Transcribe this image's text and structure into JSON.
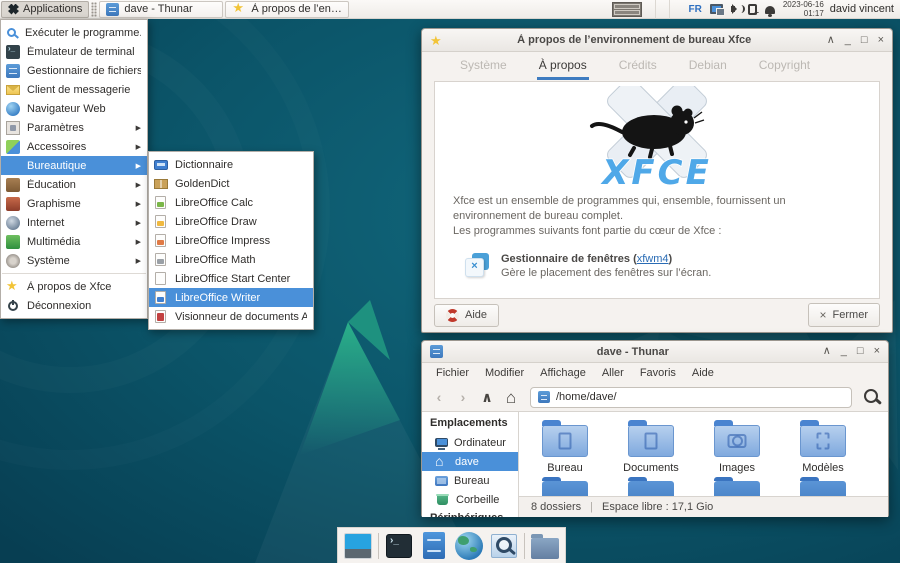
{
  "window_controls": [
    {
      "name": "shade-button",
      "glyph": "∧"
    },
    {
      "name": "minimize-button",
      "glyph": "_"
    },
    {
      "name": "maximize-button",
      "glyph": "□"
    },
    {
      "name": "close-button",
      "glyph": "×"
    }
  ],
  "panel": {
    "applications_label": "Applications",
    "task_buttons": [
      {
        "name": "taskbar-button-thunar",
        "icon": "thunar",
        "label": "dave - Thunar"
      },
      {
        "name": "taskbar-button-about",
        "icon": "star",
        "label": "À propos de l’environnem..."
      }
    ],
    "tray_language": "FR",
    "clock_date": "2023-06-16",
    "clock_time": "01:17",
    "username": "david vincent"
  },
  "apps_menu": {
    "items": [
      {
        "name": "menu-item-executer",
        "icon": "run",
        "label": "Exécuter le programme..."
      },
      {
        "name": "menu-item-terminal",
        "icon": "terminal",
        "label": "Émulateur de terminal"
      },
      {
        "name": "menu-item-gestionnaire-fichiers",
        "icon": "filecab",
        "label": "Gestionnaire de fichiers"
      },
      {
        "name": "menu-item-messagerie",
        "icon": "mail",
        "label": "Client de messagerie"
      },
      {
        "name": "menu-item-navigateur",
        "icon": "globe",
        "label": "Navigateur Web"
      },
      {
        "name": "menu-item-parametres",
        "icon": "settings",
        "label": "Paramètres",
        "has_submenu": true
      },
      {
        "name": "menu-item-accessoires",
        "icon": "accessories",
        "label": "Accessoires",
        "has_submenu": true
      },
      {
        "name": "menu-item-bureautique",
        "icon": "office",
        "label": "Bureautique",
        "has_submenu": true,
        "selected": true
      },
      {
        "name": "menu-item-education",
        "icon": "education",
        "label": "Éducation",
        "has_submenu": true
      },
      {
        "name": "menu-item-graphisme",
        "icon": "graphics",
        "label": "Graphisme",
        "has_submenu": true
      },
      {
        "name": "menu-item-internet",
        "icon": "internet",
        "label": "Internet",
        "has_submenu": true
      },
      {
        "name": "menu-item-multimedia",
        "icon": "multimedia",
        "label": "Multimédia",
        "has_submenu": true
      },
      {
        "name": "menu-item-systeme",
        "icon": "system",
        "label": "Système",
        "has_submenu": true
      },
      {
        "name": "menu-item-a-propos-xfce",
        "icon": "star",
        "label": "À propos de Xfce",
        "sep_before": true
      },
      {
        "name": "menu-item-deconnexion",
        "icon": "logout",
        "label": "Déconnexion"
      }
    ]
  },
  "office_submenu": {
    "items": [
      {
        "name": "submenu-item-dictionnaire",
        "icon": "dict",
        "label": "Dictionnaire"
      },
      {
        "name": "submenu-item-goldendict",
        "icon": "goldendict",
        "label": "GoldenDict"
      },
      {
        "name": "submenu-item-libreoffice-calc",
        "icon": "lo-calc",
        "label": "LibreOffice Calc"
      },
      {
        "name": "submenu-item-libreoffice-draw",
        "icon": "lo-draw",
        "label": "LibreOffice Draw"
      },
      {
        "name": "submenu-item-libreoffice-impress",
        "icon": "lo-impress",
        "label": "LibreOffice Impress"
      },
      {
        "name": "submenu-item-libreoffice-math",
        "icon": "lo-math",
        "label": "LibreOffice Math"
      },
      {
        "name": "submenu-item-libreoffice-start-center",
        "icon": "lo-start",
        "label": "LibreOffice Start Center"
      },
      {
        "name": "submenu-item-libreoffice-writer",
        "icon": "lo-writer",
        "label": "LibreOffice Writer",
        "selected": true
      },
      {
        "name": "submenu-item-atril",
        "icon": "atril",
        "label": "Visionneur de documents Atril"
      }
    ]
  },
  "about_window": {
    "title": "À propos de l’environnement de bureau Xfce",
    "tabs": [
      {
        "name": "tab-systeme",
        "label": "Système"
      },
      {
        "name": "tab-a-propos",
        "label": "À propos",
        "active": true
      },
      {
        "name": "tab-credits",
        "label": "Crédits"
      },
      {
        "name": "tab-debian",
        "label": "Debian"
      },
      {
        "name": "tab-copyright",
        "label": "Copyright"
      }
    ],
    "logo_text": "XFCE",
    "para1": "Xfce est un ensemble de programmes qui, ensemble, fournissent un environnement de bureau complet.",
    "para2": "Les programmes suivants font partie du cœur de Xfce :",
    "program_name": "Gestionnaire de fenêtres",
    "paren_open": "(",
    "program_link": "xfwm4",
    "paren_close": ")",
    "program_desc": "Gère le placement des fenêtres sur l’écran.",
    "help_label": "Aide",
    "close_glyph": "×",
    "close_label": "Fermer"
  },
  "thunar_window": {
    "title": "dave - Thunar",
    "menus": [
      {
        "name": "thunar-menu-fichier",
        "label": "Fichier"
      },
      {
        "name": "thunar-menu-modifier",
        "label": "Modifier"
      },
      {
        "name": "thunar-menu-affichage",
        "label": "Affichage"
      },
      {
        "name": "thunar-menu-aller",
        "label": "Aller"
      },
      {
        "name": "thunar-menu-favoris",
        "label": "Favoris"
      },
      {
        "name": "thunar-menu-aide",
        "label": "Aide"
      }
    ],
    "nav_back": "‹",
    "nav_forward": "›",
    "nav_up": "∧",
    "nav_home": "⌂",
    "path": "/home/dave/",
    "sidebar_header": "Emplacements",
    "sidebar_items": [
      {
        "name": "sidebar-item-ordinateur",
        "icon": "computer",
        "label": "Ordinateur"
      },
      {
        "name": "sidebar-item-dave",
        "icon": "home",
        "label": "dave",
        "selected": true
      },
      {
        "name": "sidebar-item-bureau",
        "icon": "desktop",
        "label": "Bureau"
      },
      {
        "name": "sidebar-item-corbeille",
        "icon": "trash",
        "label": "Corbeille"
      }
    ],
    "sidebar_header2": "Périphériques",
    "folders": [
      {
        "name": "folder-bureau",
        "emblem": "doc",
        "label": "Bureau"
      },
      {
        "name": "folder-documents",
        "emblem": "doc",
        "label": "Documents"
      },
      {
        "name": "folder-images",
        "emblem": "camera",
        "label": "Images"
      },
      {
        "name": "folder-modeles",
        "emblem": "template",
        "label": "Modèles"
      }
    ],
    "status_count": "8 dossiers",
    "status_sep": "|",
    "status_free": "Espace libre : 17,1 Gio"
  },
  "dock": {
    "items": [
      {
        "name": "dock-item-desktop",
        "icon": "dock-desktop"
      },
      {
        "type": "sep"
      },
      {
        "name": "dock-item-terminal",
        "icon": "dock-terminal"
      },
      {
        "name": "dock-item-file-manager",
        "icon": "dock-filecab"
      },
      {
        "name": "dock-item-web-browser",
        "icon": "dock-globe"
      },
      {
        "name": "dock-item-app-finder",
        "icon": "dock-finder"
      },
      {
        "type": "sep"
      },
      {
        "name": "dock-item-folder",
        "icon": "dock-folder"
      }
    ]
  },
  "colors": {
    "selection_blue": "#4a90d9",
    "tab_underline": "#3e7cc0",
    "desktop_teal": "#0b5a6e",
    "panel_bg": "#f5f2ef"
  }
}
